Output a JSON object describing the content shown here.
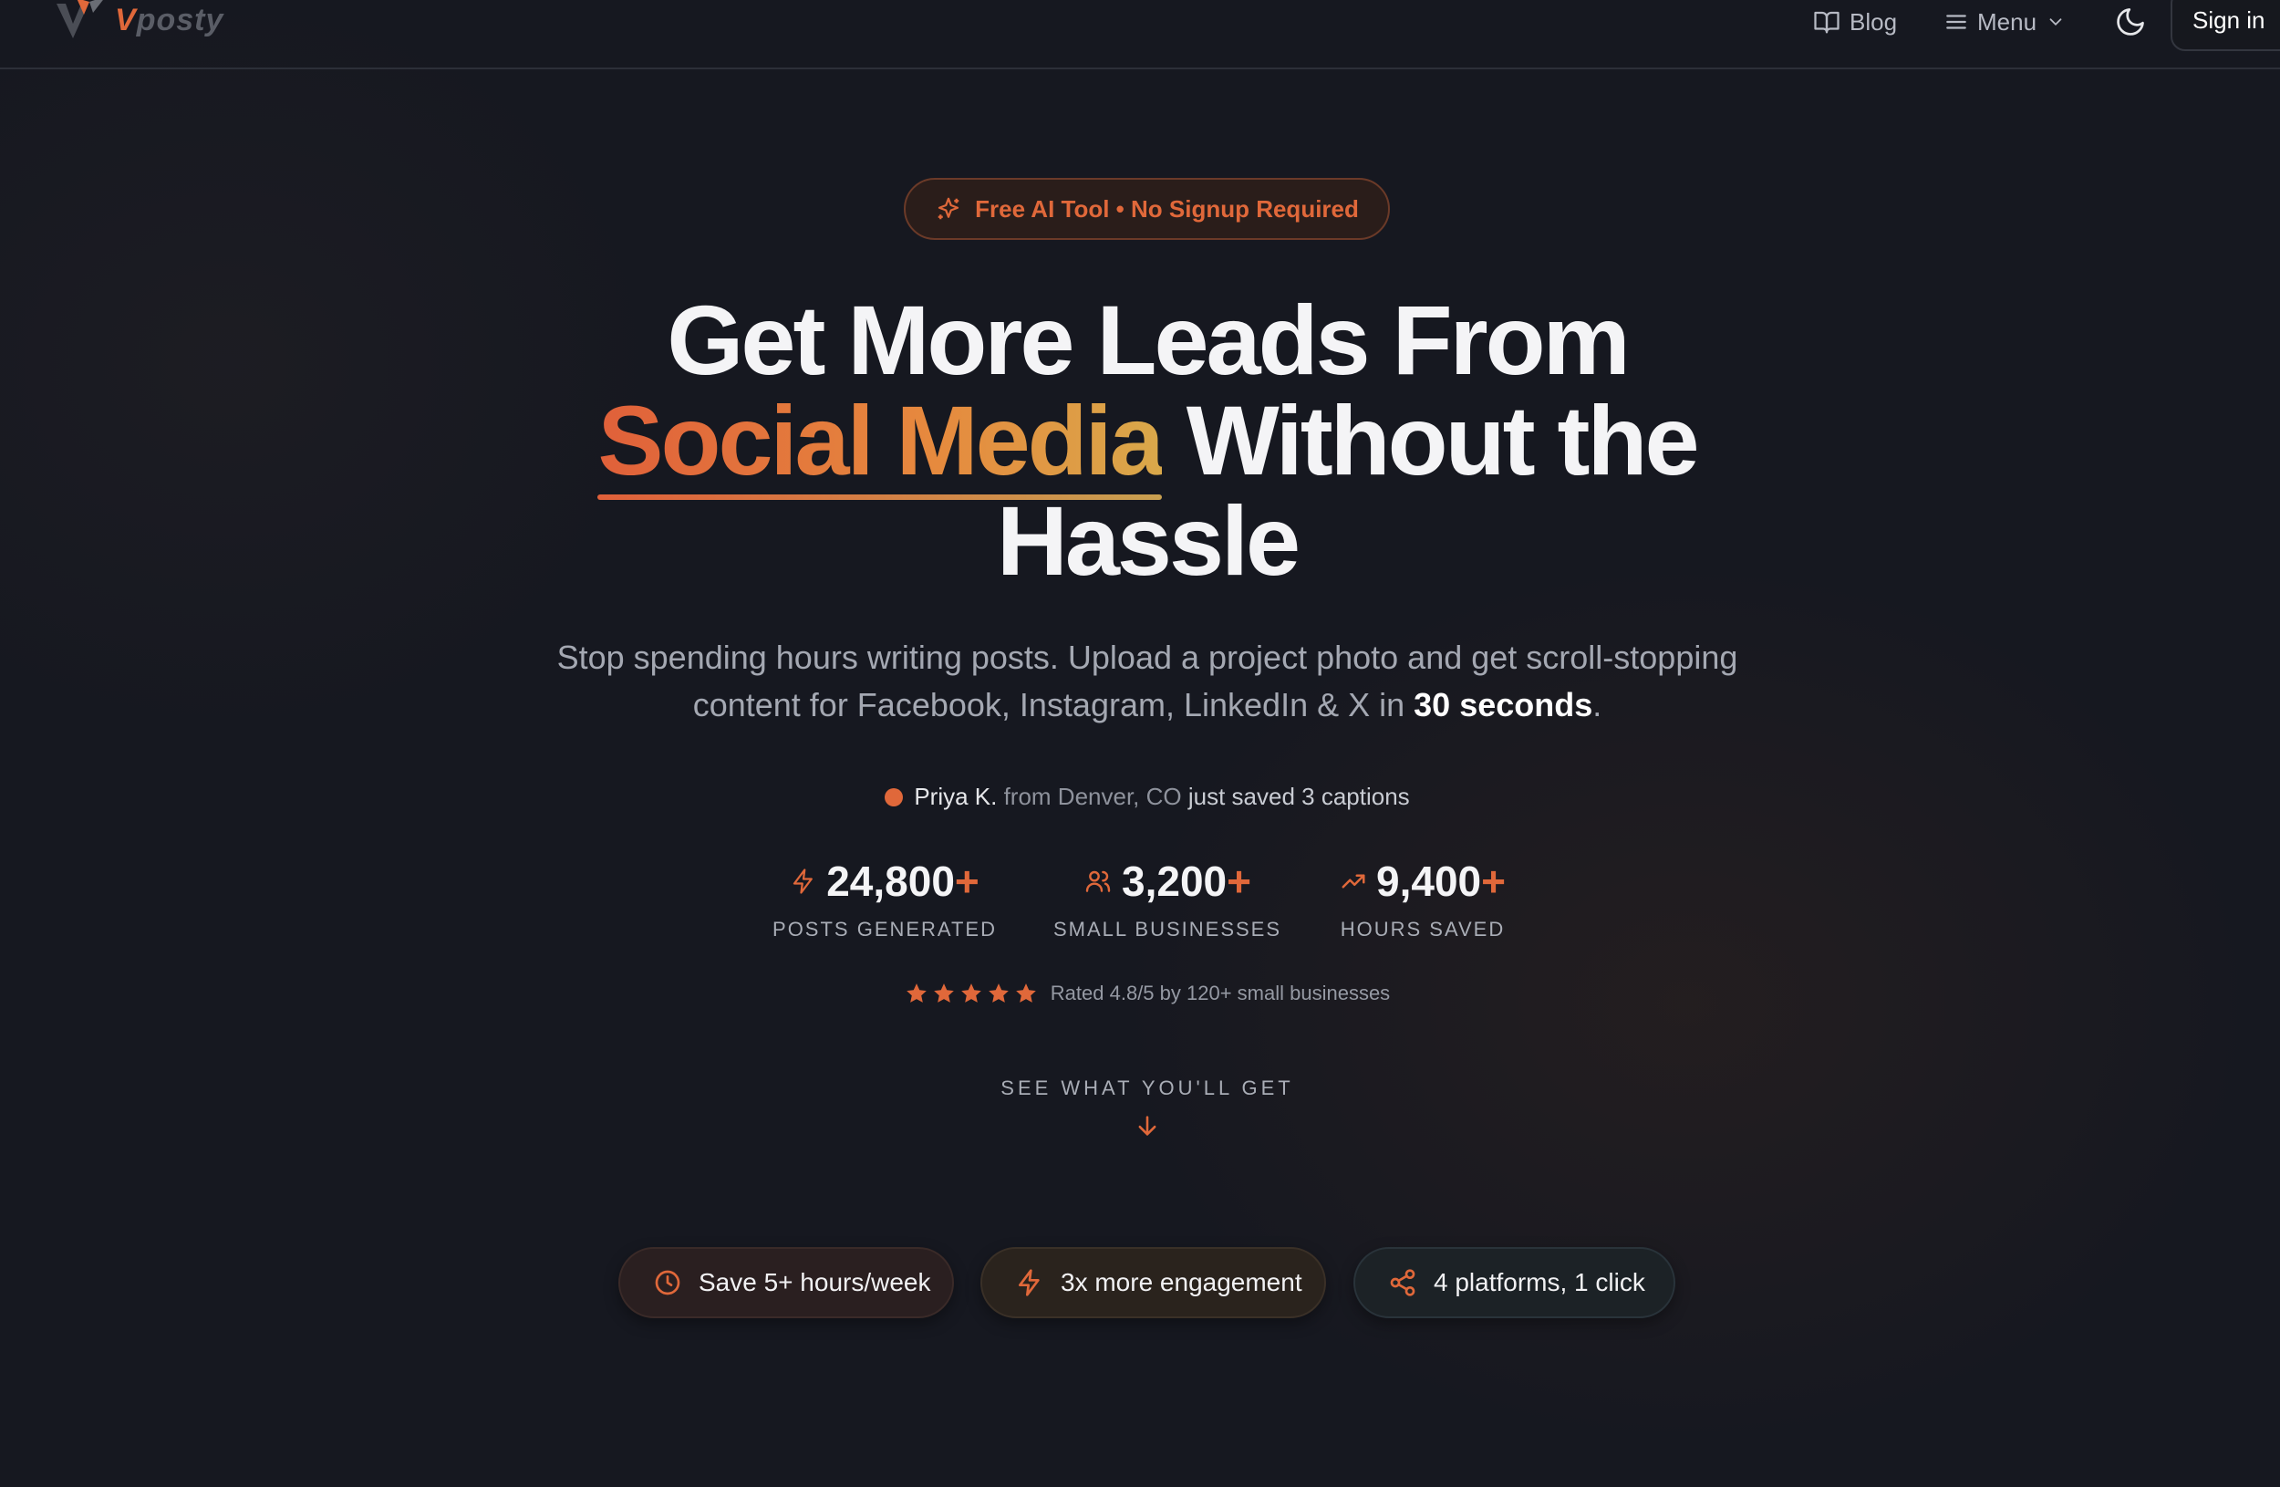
{
  "header": {
    "logo": {
      "v": "V",
      "rest": "posty"
    },
    "nav": {
      "blog": "Blog",
      "menu": "Menu"
    },
    "sign_in": "Sign in"
  },
  "hero": {
    "badge": "Free AI Tool • No Signup Required",
    "headline": {
      "line1": "Get More Leads From",
      "accent": "Social Media",
      "after_accent": "Without the",
      "line3": "Hassle"
    },
    "subtitle": {
      "text": "Stop spending hours writing posts. Upload a project photo and get scroll-stopping content for Facebook, Instagram, LinkedIn & X in",
      "emphasis": "30 seconds",
      "end": "."
    },
    "activity": {
      "name": "Priya K.",
      "location": "from Denver, CO",
      "action": "just saved 3 captions"
    },
    "stats": [
      {
        "icon": "bolt-icon",
        "value": "24,800",
        "suffix": "+",
        "label": "POSTS GENERATED"
      },
      {
        "icon": "users-icon",
        "value": "3,200",
        "suffix": "+",
        "label": "SMALL BUSINESSES"
      },
      {
        "icon": "trending-up-icon",
        "value": "9,400",
        "suffix": "+",
        "label": "HOURS SAVED"
      }
    ],
    "rating": {
      "stars": 5,
      "text": "Rated 4.8/5 by 120+ small businesses"
    },
    "see_more": "SEE WHAT YOU'LL GET"
  },
  "pills": [
    {
      "icon": "clock-icon",
      "label": "Save 5+ hours/week"
    },
    {
      "icon": "bolt-icon",
      "label": "3x more engagement"
    },
    {
      "icon": "share-icon",
      "label": "4 platforms, 1 click"
    }
  ],
  "colors": {
    "accent": "#e0683a",
    "background": "#161820"
  }
}
